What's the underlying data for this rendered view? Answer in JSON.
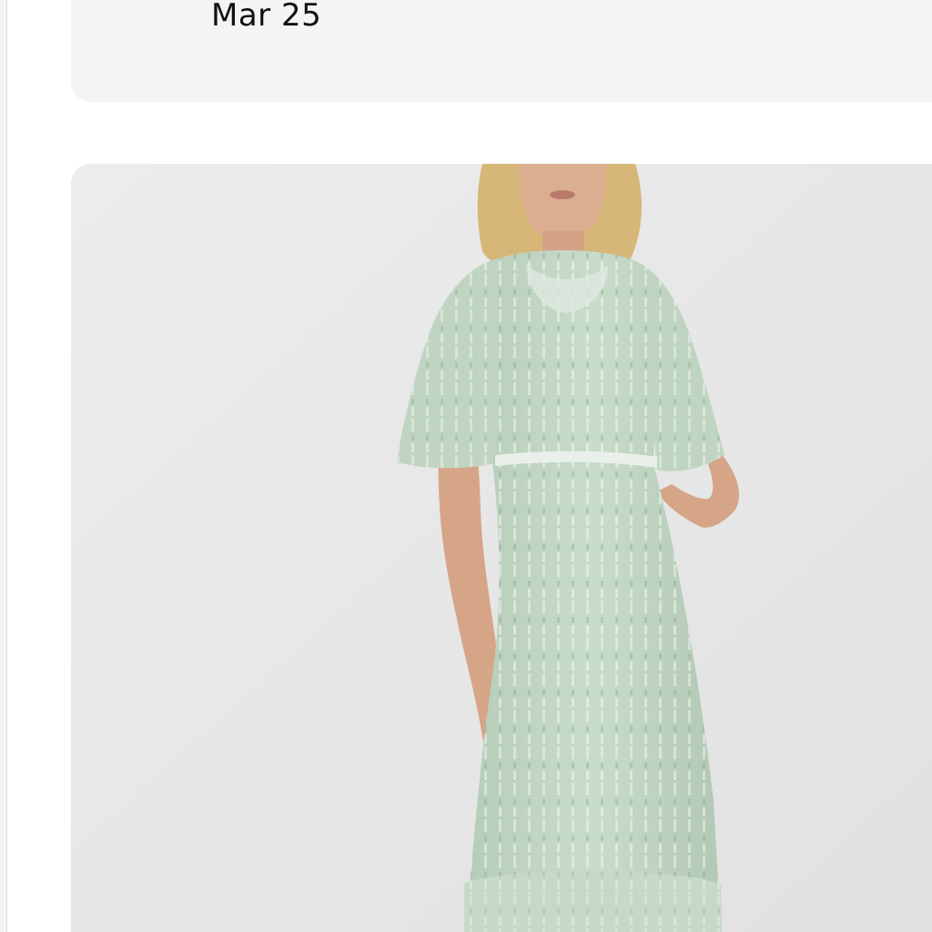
{
  "listing": {
    "date_label": "Mar 25"
  },
  "photo": {
    "subject": "dress-photo",
    "background_color": "#e6e6e6",
    "dress_color": "#bfd5c2",
    "sequin_color": "#eef3ef",
    "skin_color": "#d9a98a",
    "hair_color": "#d9b978"
  }
}
